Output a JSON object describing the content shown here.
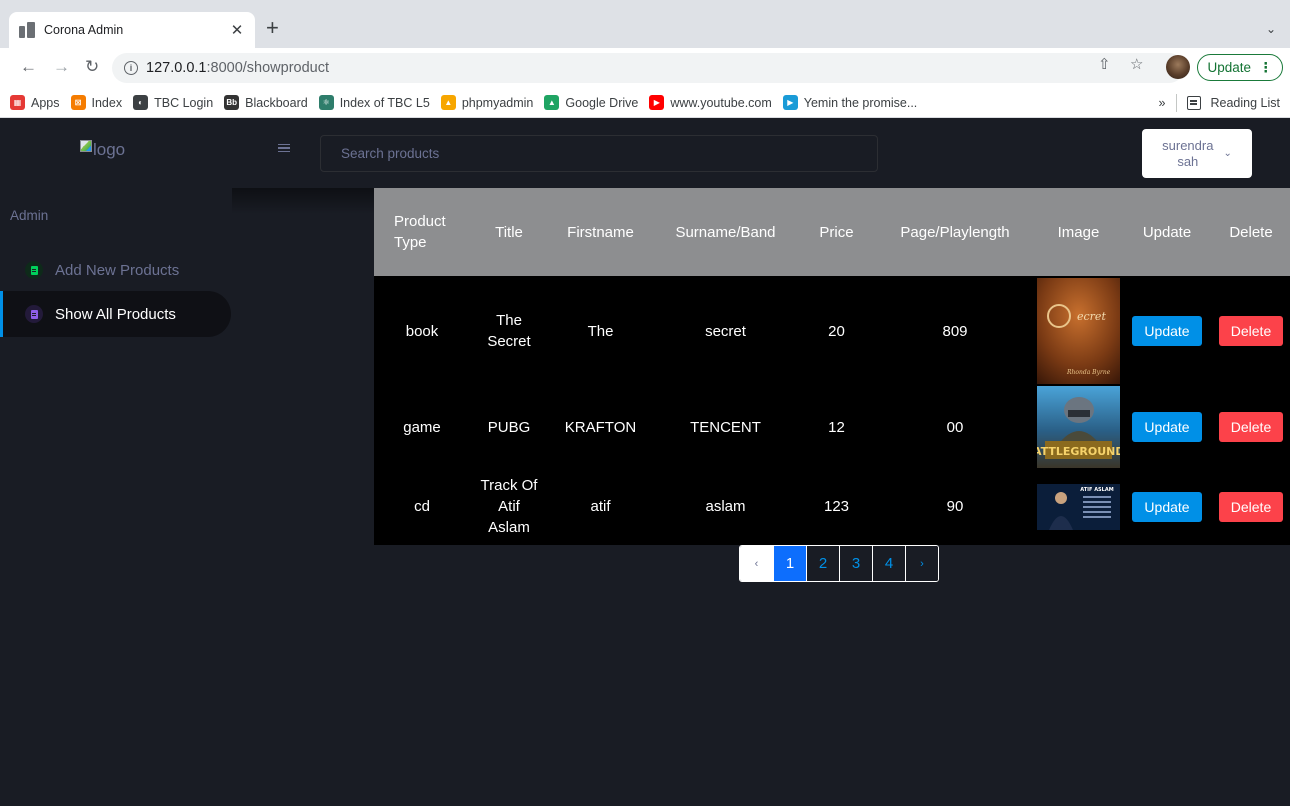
{
  "browser": {
    "tab_title": "Corona Admin",
    "new_tab": "+",
    "tab_search": "⌄",
    "url_host": "127.0.0.1",
    "url_path": ":8000/showproduct",
    "update_label": "Update",
    "bookmarks": [
      {
        "label": "Apps",
        "color": "#e53935"
      },
      {
        "label": "Index",
        "color": "#f57c00"
      },
      {
        "label": "TBC Login",
        "color": "#3c4043"
      },
      {
        "label": "Blackboard",
        "color": "#333333"
      },
      {
        "label": "Index of TBC L5",
        "color": "#2e7d6b"
      },
      {
        "label": "phpmyadmin",
        "color": "#f7a600"
      },
      {
        "label": "Google Drive",
        "color": "#1fa463"
      },
      {
        "label": "www.youtube.com",
        "color": "#ff0000"
      },
      {
        "label": "Yemin the promise...",
        "color": "#1a9bd7"
      }
    ],
    "bookmarks_overflow": "»",
    "reading_list": "Reading List"
  },
  "app": {
    "logo_alt": "logo",
    "search_placeholder": "Search products",
    "user": {
      "line1": "surendra",
      "line2": "sah"
    },
    "sidebar": {
      "title": "Admin",
      "items": [
        {
          "label": "Add New Products",
          "icon_color": "#00d25b",
          "active": false
        },
        {
          "label": "Show All Products",
          "icon_color": "#8f5fe8",
          "active": true
        }
      ]
    },
    "table": {
      "headers": [
        "Product Type",
        "Title",
        "Firstname",
        "Surname/Band",
        "Price",
        "Page/Playlength",
        "Image",
        "Update",
        "Delete"
      ],
      "rows": [
        {
          "type": "book",
          "title": "The Secret",
          "firstname": "The",
          "surname": "secret",
          "price": "20",
          "length": "809",
          "image": "the-secret-cover",
          "update": "Update",
          "delete": "Delete"
        },
        {
          "type": "game",
          "title": "PUBG",
          "firstname": "KRAFTON",
          "surname": "TENCENT",
          "price": "12",
          "length": "00",
          "image": "pubg-cover",
          "update": "Update",
          "delete": "Delete"
        },
        {
          "type": "cd",
          "title": "Track Of Atif Aslam",
          "firstname": "atif",
          "surname": "aslam",
          "price": "123",
          "length": "90",
          "image": "atif-aslam-cover",
          "update": "Update",
          "delete": "Delete"
        }
      ]
    },
    "pagination": {
      "prev": "‹",
      "pages": [
        "1",
        "2",
        "3",
        "4"
      ],
      "active": "1",
      "next": "›"
    }
  },
  "colors": {
    "background": "#191c24",
    "primary": "#0090e7",
    "danger": "#fc424a",
    "header_gray": "#8d8e90",
    "muted": "#6c7293"
  }
}
